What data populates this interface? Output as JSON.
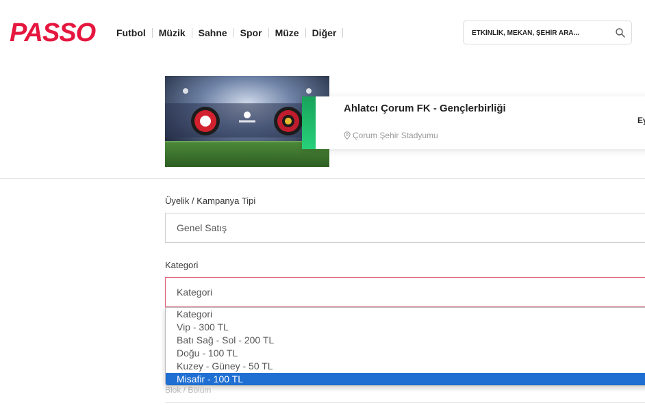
{
  "header": {
    "logo": "PASSO",
    "nav": [
      "Futbol",
      "Müzik",
      "Sahne",
      "Spor",
      "Müze",
      "Diğer"
    ],
    "search_placeholder": "ETKİNLİK, MEKAN, ŞEHİR ARA..."
  },
  "event": {
    "title": "Ahlatcı Çorum FK - Gençlerbirliği",
    "venue": "Çorum Şehir Stadyumu",
    "date_partial": "Ey"
  },
  "form": {
    "membership_label": "Üyelik / Kampanya Tipi",
    "membership_value": "Genel Satış",
    "category_label": "Kategori",
    "category_value": "Kategori",
    "category_options": [
      "Kategori",
      "Vip - 300 TL",
      "Batı Sağ - Sol - 200 TL",
      "Doğu - 100 TL",
      "Kuzey - Güney - 50 TL",
      "Misafir - 100 TL"
    ],
    "highlighted_option": "Misafir - 100 TL",
    "block_label": "Blok / Bölüm"
  },
  "colors": {
    "brand": "#e5173f",
    "accent_green": "#18a35a",
    "selected_option": "#1f6fd2"
  }
}
